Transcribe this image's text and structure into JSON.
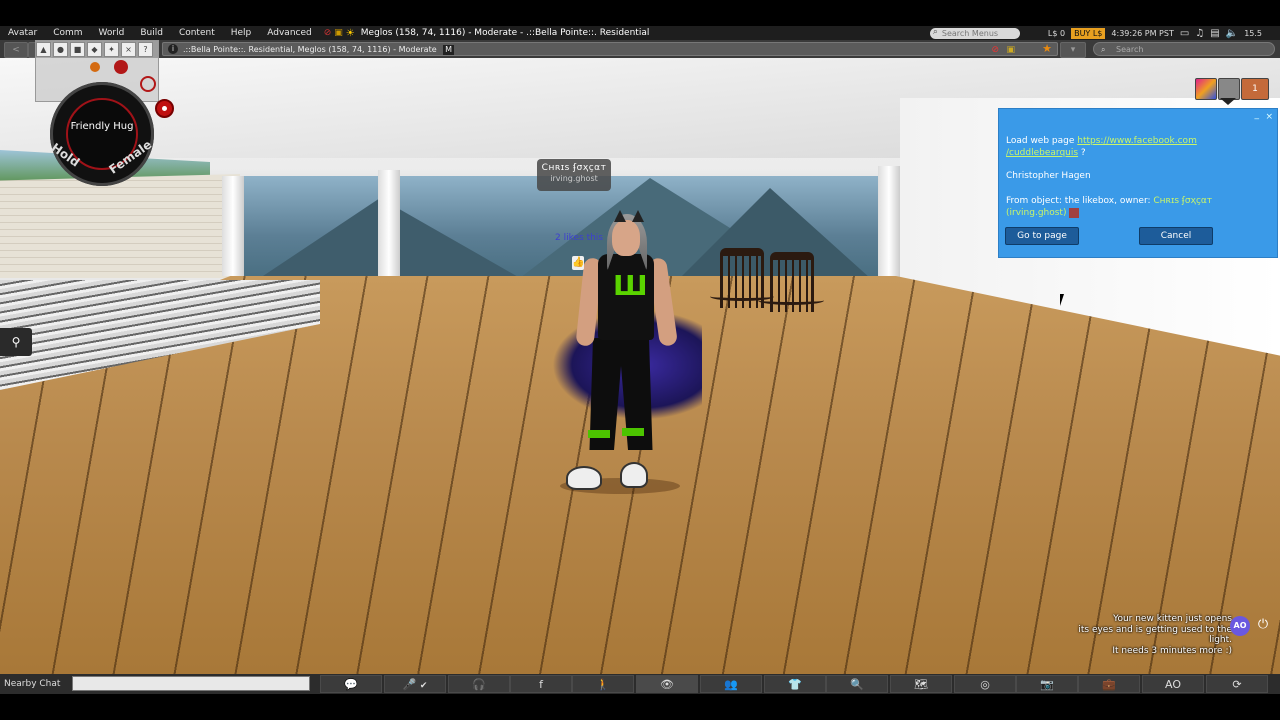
{
  "menu": {
    "items": [
      "Avatar",
      "Comm",
      "World",
      "Build",
      "Content",
      "Help",
      "Advanced"
    ],
    "region_title": "Meglos (158, 74, 1116) - Moderate - .::Bella Pointe::. Residential",
    "search_placeholder": "Search Menus",
    "balance": "L$ 0",
    "buy_label": "BUY L$",
    "time": "4:39:26 PM PST",
    "fps": "15.5"
  },
  "navbar": {
    "back_icon": "<",
    "forward_icon": ">",
    "location": ".::Bella Pointe::. Residential, Meglos (158, 74, 1116) - Moderate",
    "maturity_badge": "M",
    "search_placeholder": "Search"
  },
  "hud": {
    "gesture_label": "Friendly Hug",
    "hold_label": "Hold",
    "female_label": "Female"
  },
  "avatar": {
    "display_name": "Cʜʀɪs ʄσҳçαт",
    "username": "irving.ghost",
    "likes_text": "2 likes this"
  },
  "dialog": {
    "prefix": "Load web page ",
    "url_line1": "https://www.facebook.com",
    "url_line2": "/cuddlebearquis",
    "url_suffix": " ?",
    "recipient": "Christopher Hagen",
    "from_prefix": "From object: the likebox, owner: ",
    "owner_name": "Cʜʀɪs ʄσҳçαт",
    "owner_username": "(irving.ghost)",
    "go_label": "Go to page",
    "cancel_label": "Cancel",
    "close_icon": "×",
    "minimize_icon": "_"
  },
  "notice": {
    "lines": [
      "Your new kitten just opens",
      "its eyes and is getting used to the light.",
      "It needs 3 minutes more :)"
    ],
    "ao_label": "AO",
    "power_icon": "⏻"
  },
  "bottombar": {
    "nearby_label": "Nearby Chat",
    "ao_label": "AO"
  },
  "colors": {
    "dialog_bg": "#3a9ae8",
    "link": "#c8f56a",
    "buy_bg": "#e8a020",
    "bar_bg": "#2c2c2c"
  }
}
